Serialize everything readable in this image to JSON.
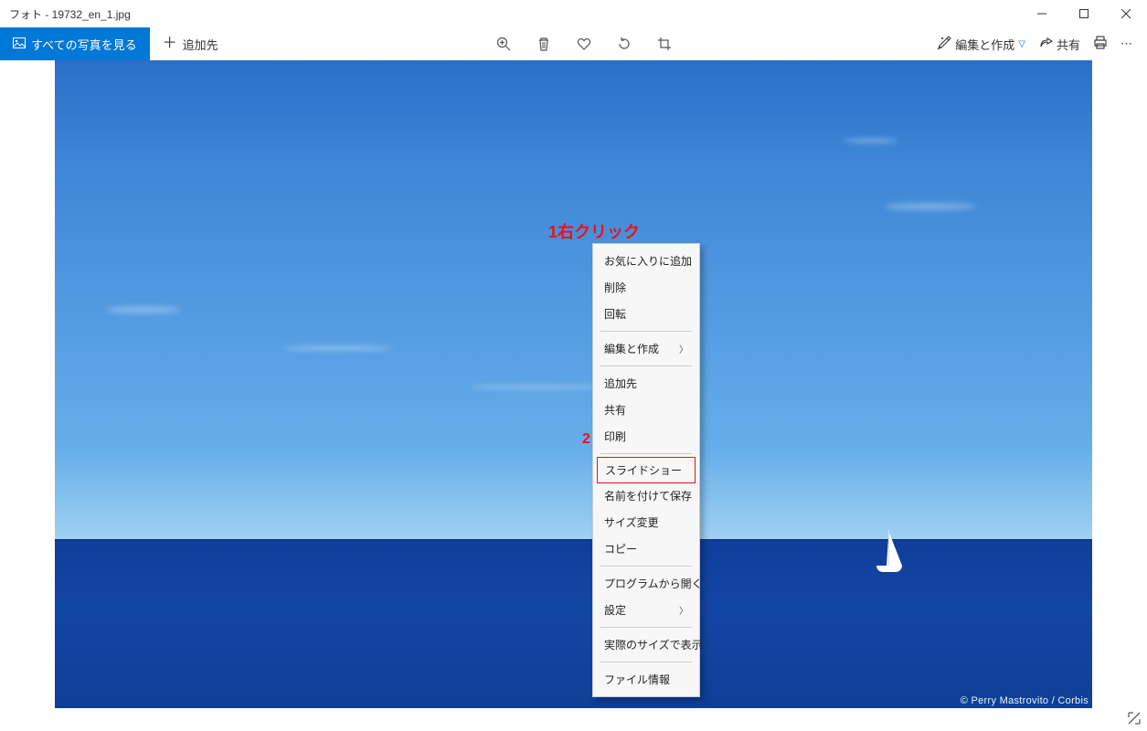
{
  "window": {
    "title": "フォト - 19732_en_1.jpg"
  },
  "toolbar": {
    "see_all_photos": "すべての写真を見る",
    "add_to": "追加先",
    "edit_create": "編集と作成",
    "share": "共有",
    "icons": {
      "zoom": "zoom-icon",
      "delete": "delete-icon",
      "favorite": "favorite-icon",
      "rotate": "rotate-icon",
      "crop": "crop-icon",
      "edit": "edit-icon",
      "share": "share-icon",
      "print": "print-icon",
      "more": "more-icon"
    }
  },
  "image": {
    "credit": "© Perry Mastrovito / Corbis"
  },
  "annotations": {
    "a1": "1右クリック",
    "a2": "2"
  },
  "context_menu": {
    "groups": [
      {
        "items": [
          {
            "label": "お気に入りに追加"
          },
          {
            "label": "削除"
          },
          {
            "label": "回転"
          }
        ]
      },
      {
        "items": [
          {
            "label": "編集と作成",
            "submenu": true
          }
        ]
      },
      {
        "items": [
          {
            "label": "追加先"
          },
          {
            "label": "共有"
          },
          {
            "label": "印刷"
          }
        ]
      },
      {
        "items": [
          {
            "label": "スライドショー",
            "highlighted": true
          },
          {
            "label": "名前を付けて保存"
          },
          {
            "label": "サイズ変更"
          },
          {
            "label": "コピー"
          }
        ]
      },
      {
        "items": [
          {
            "label": "プログラムから開く"
          },
          {
            "label": "設定",
            "submenu": true
          }
        ]
      },
      {
        "items": [
          {
            "label": "実際のサイズで表示"
          }
        ]
      },
      {
        "items": [
          {
            "label": "ファイル情報"
          }
        ]
      }
    ]
  }
}
